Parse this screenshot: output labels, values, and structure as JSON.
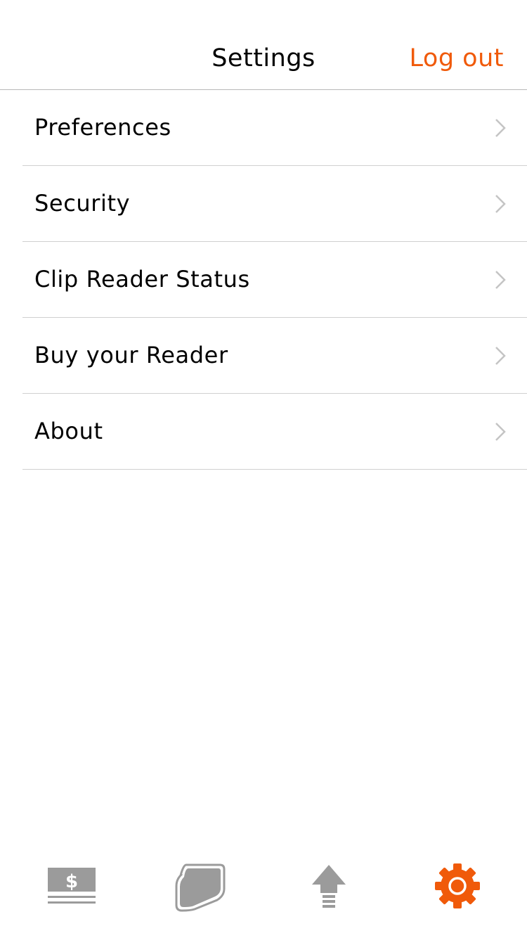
{
  "header": {
    "title": "Settings",
    "logout_label": "Log out"
  },
  "menu": {
    "items": [
      {
        "label": "Preferences"
      },
      {
        "label": "Security"
      },
      {
        "label": "Clip Reader Status"
      },
      {
        "label": "Buy your Reader"
      },
      {
        "label": "About"
      }
    ]
  },
  "tab_bar": {
    "tabs": [
      {
        "icon": "cash-icon",
        "dollar_glyph": "$",
        "active": false
      },
      {
        "icon": "card-icon",
        "active": false
      },
      {
        "icon": "upload-arrow-icon",
        "active": false
      },
      {
        "icon": "gear-icon",
        "active": true
      }
    ]
  },
  "colors": {
    "accent": "#f05a0a",
    "icon_inactive": "#9b9b9b",
    "divider": "#d0d0d0",
    "chevron": "#c4c4c4",
    "text": "#000000"
  }
}
